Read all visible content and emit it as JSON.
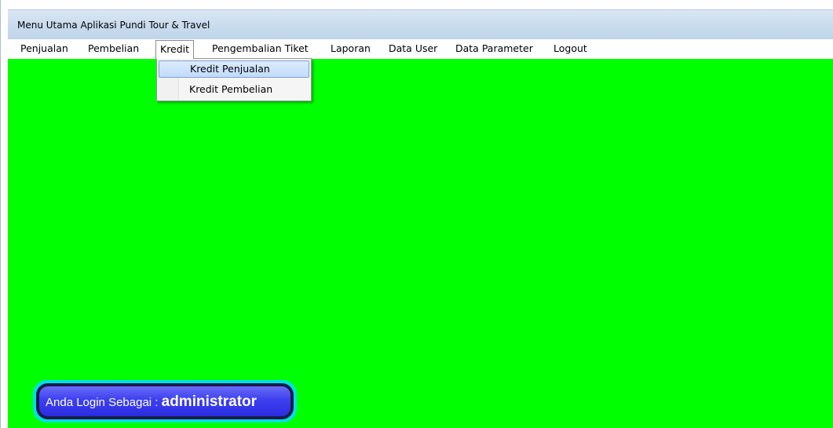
{
  "window": {
    "title": "Menu Utama Aplikasi Pundi Tour & Travel"
  },
  "menubar": {
    "items": [
      {
        "label": "Penjualan"
      },
      {
        "label": "Pembelian"
      },
      {
        "label": "Kredit",
        "open": true
      },
      {
        "label": "Pengembalian Tiket"
      },
      {
        "label": "Laporan"
      },
      {
        "label": "Data User"
      },
      {
        "label": "Data Parameter"
      },
      {
        "label": "Logout"
      }
    ]
  },
  "dropdown": {
    "parent": "Kredit",
    "items": [
      {
        "label": "Kredit Penjualan",
        "highlighted": true
      },
      {
        "label": "Kredit Pembelian",
        "highlighted": false
      }
    ]
  },
  "status": {
    "login_label": "Anda Login Sebagai : ",
    "user_role": "administrator"
  },
  "colors": {
    "content_background": "#00ff00",
    "badge_outline": "#00e0e8",
    "badge_fill": "#3d3ff0",
    "menu_highlight": "#c1dbfc"
  }
}
